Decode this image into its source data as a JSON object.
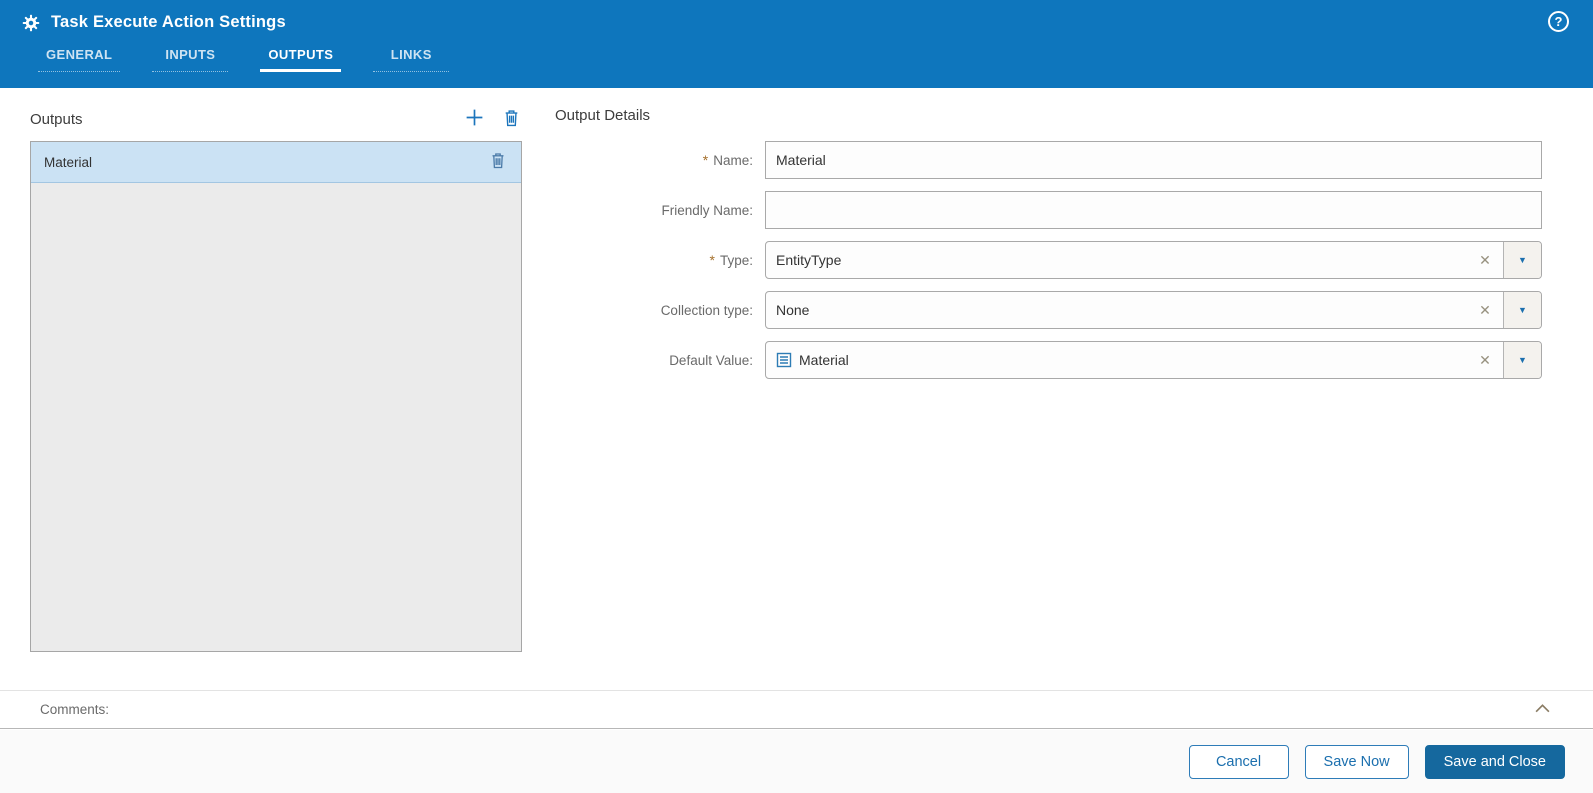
{
  "dialog": {
    "title": "Task Execute Action Settings"
  },
  "icons": {
    "help": "?",
    "clear": "✕",
    "dropdown_arrow": "▼",
    "required_marker": "*"
  },
  "tabs": [
    {
      "label": "GENERAL",
      "active": false
    },
    {
      "label": "INPUTS",
      "active": false
    },
    {
      "label": "OUTPUTS",
      "active": true
    },
    {
      "label": "LINKS",
      "active": false
    }
  ],
  "outputs_panel": {
    "title": "Outputs",
    "items": [
      {
        "name": "Material",
        "selected": true
      }
    ]
  },
  "details": {
    "title": "Output Details",
    "name_label": "Name:",
    "name_value": "Material",
    "friendly_name_label": "Friendly Name:",
    "friendly_name_value": "",
    "type_label": "Type:",
    "type_value": "EntityType",
    "collection_type_label": "Collection type:",
    "collection_type_value": "None",
    "default_value_label": "Default Value:",
    "default_value_value": "Material"
  },
  "comments": {
    "label": "Comments:"
  },
  "footer": {
    "cancel": "Cancel",
    "save_now": "Save Now",
    "save_and_close": "Save and Close"
  },
  "colors": {
    "header_blue": "#0e76bd",
    "accent_blue": "#1c75bc",
    "selected_row": "#cbe2f4",
    "primary_button": "#15689e"
  }
}
